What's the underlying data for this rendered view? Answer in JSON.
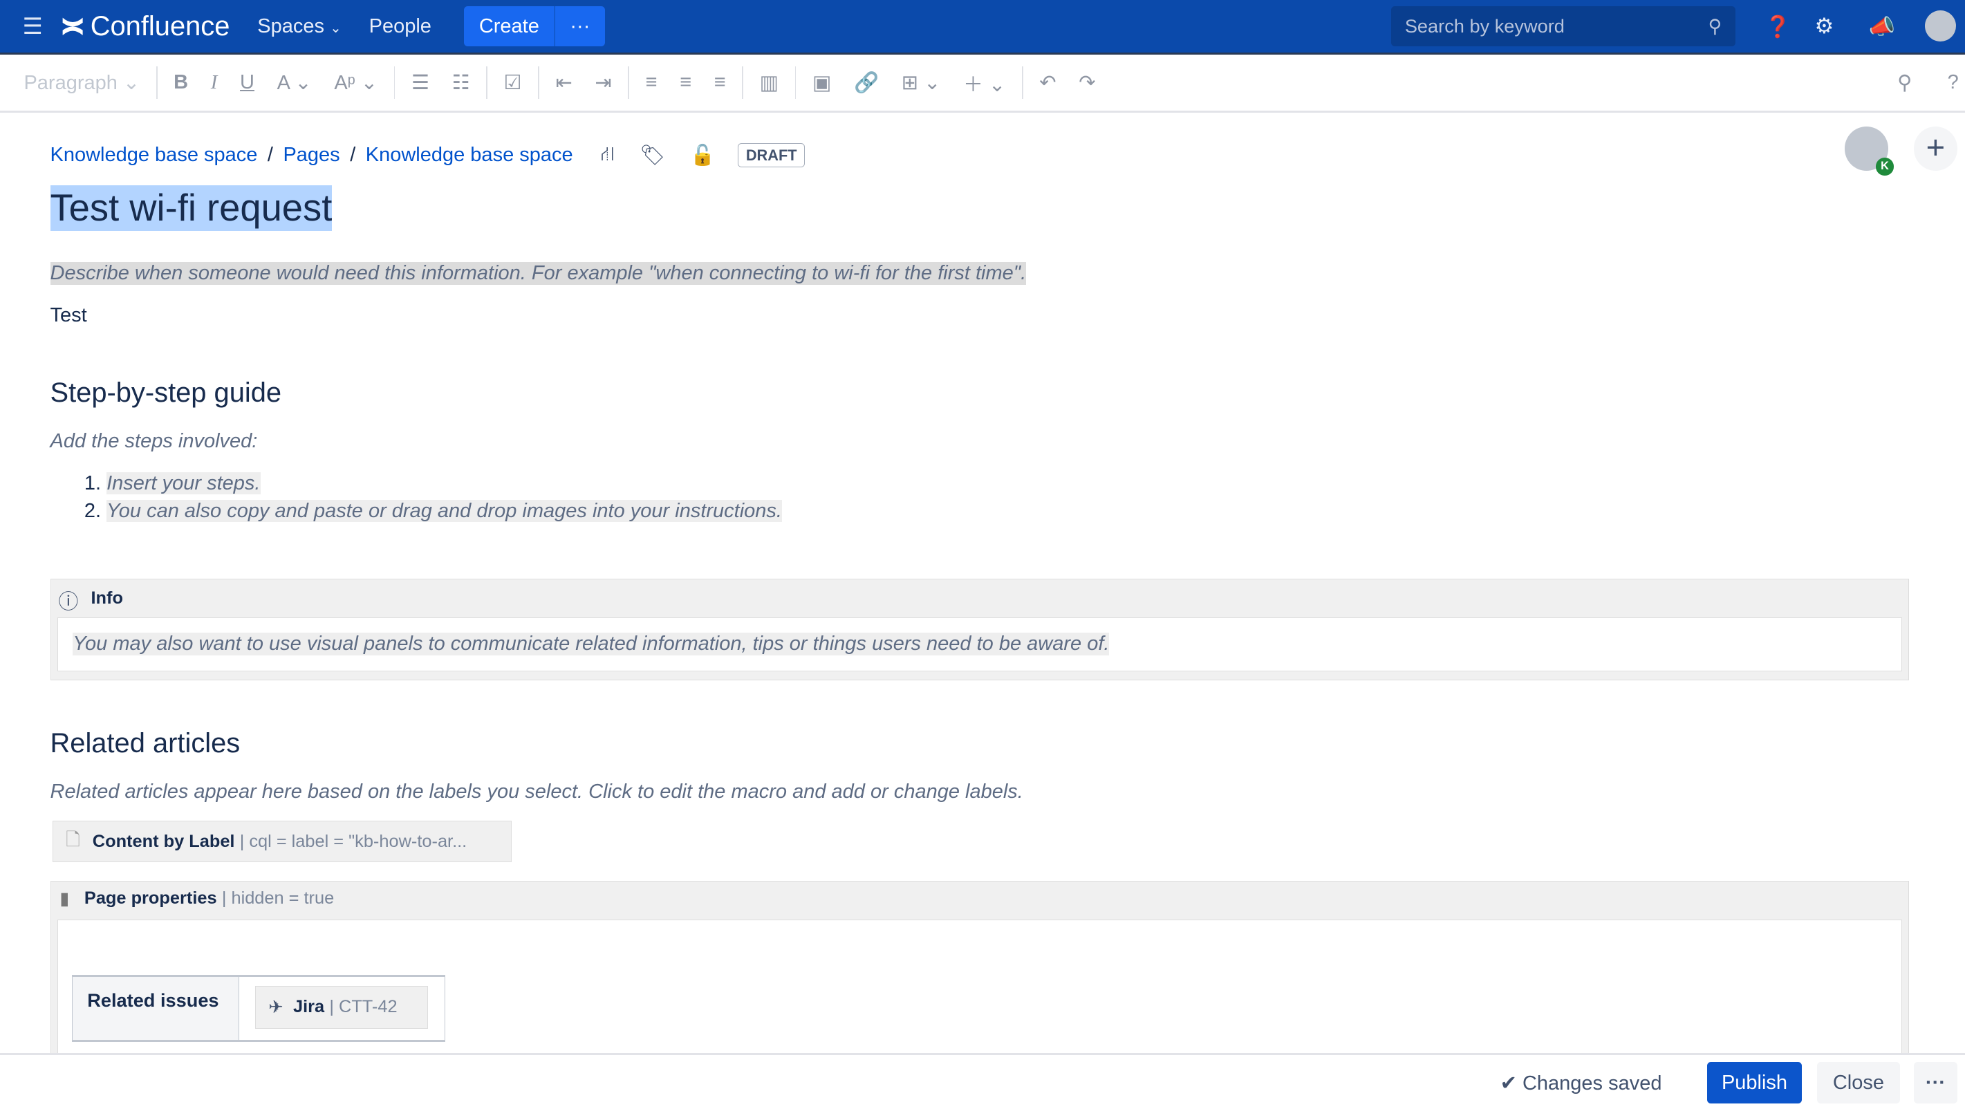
{
  "topbar": {
    "app": "Confluence",
    "spaces": "Spaces",
    "people": "People",
    "create": "Create",
    "more": "···",
    "search_placeholder": "Search by keyword"
  },
  "toolbar": {
    "paragraph": "Paragraph"
  },
  "breadcrumb": [
    "Knowledge base space",
    "Pages",
    "Knowledge base space"
  ],
  "status": "DRAFT",
  "avatar_badge": "K",
  "page": {
    "title": "Test wi-fi request",
    "intro": "Describe when someone would need this information. For example \"when connecting to wi-fi for the first time\".",
    "body": "Test",
    "h_steps": "Step-by-step guide",
    "steps_intro": "Add the steps involved:",
    "steps": [
      "Insert your steps.",
      "You can also copy and paste or drag and drop images into your instructions."
    ],
    "info_title": "Info",
    "info_text": "You may also want to use visual panels to communicate related information, tips or things users need to be aware of.",
    "h_related": "Related articles",
    "related_text": "Related articles appear here based on the labels you select. Click to edit the macro and add or change labels.",
    "cbl_name": "Content by Label",
    "cbl_params": "| cql = label = \"kb-how-to-ar...",
    "pp_name": "Page properties",
    "pp_params": "| hidden = true",
    "related_issues": "Related issues",
    "jira_name": "Jira",
    "jira_params": "| CTT-42"
  },
  "footer": {
    "saved": "Changes saved",
    "publish": "Publish",
    "close": "Close",
    "more": "···"
  }
}
